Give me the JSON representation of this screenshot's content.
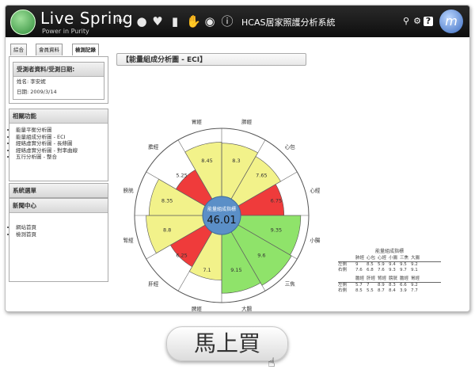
{
  "header": {
    "brand": "Live Spring",
    "inc": "Inc.",
    "tagline": "Power in Purity",
    "title": "HCAS居家照護分析系統",
    "icons": [
      "person-icon",
      "heart-icon",
      "bar-chart-icon",
      "hand-icon",
      "speech-bubble-icon",
      "info-icon"
    ],
    "tools": [
      "search-icon",
      "gear-icon",
      "help-icon"
    ],
    "logo_letter": "m"
  },
  "sidebar": {
    "tabs": [
      "綜合",
      "會員資料",
      "檢測記錄"
    ],
    "recipient": {
      "title": "受測者資料/受測日期:",
      "name": "姓名: 李安妮",
      "date": "日期: 2009/3/14"
    },
    "functions": {
      "title": "相關功能",
      "items": [
        "能量平衡分析圖",
        "能量組成分析圖 - ECI",
        "經絡虛實分析圖 - 長條圖",
        "經絡虛實分析圖 - 對率曲線",
        "五行分析圖 - 整合"
      ]
    },
    "system": {
      "title": "系統選單"
    },
    "news": {
      "title": "新聞中心",
      "items": [
        "網站首頁",
        "檢測首頁"
      ]
    }
  },
  "main": {
    "title": "【能量組成分析圖 - ECI】"
  },
  "chart_data": {
    "type": "radial-bar",
    "center_label": "能量組成指標",
    "center_value": "46.01",
    "segments": [
      {
        "name": "肺經",
        "value": 8.3,
        "color": "#f2f28a"
      },
      {
        "name": "心包",
        "value": 7.65,
        "color": "#f2f28a"
      },
      {
        "name": "心經",
        "value": 6.75,
        "color": "#ef3b3b"
      },
      {
        "name": "小腸",
        "value": 9.35,
        "color": "#8fe36a"
      },
      {
        "name": "三焦",
        "value": 9.6,
        "color": "#8fe36a"
      },
      {
        "name": "大腸",
        "value": 9.15,
        "color": "#8fe36a"
      },
      {
        "name": "脾經",
        "value": 7.1,
        "color": "#f2f28a"
      },
      {
        "name": "肝經",
        "value": 6.25,
        "color": "#ef3b3b"
      },
      {
        "name": "腎經",
        "value": 8.8,
        "color": "#f2f28a"
      },
      {
        "name": "膀胱",
        "value": 8.35,
        "color": "#f2f28a"
      },
      {
        "name": "膽經",
        "value": 5.25,
        "color": "#ef3b3b"
      },
      {
        "name": "胃經",
        "value": 8.45,
        "color": "#f2f28a"
      }
    ]
  },
  "legend": {
    "title": "能量組成指標",
    "top_headers": [
      "肺經",
      "心包",
      "心經",
      "小腸",
      "三焦",
      "大腸"
    ],
    "top_rows": [
      {
        "label": "左側",
        "values": [
          "9",
          "8.5",
          "5.9",
          "9.4",
          "9.5",
          "9.2"
        ]
      },
      {
        "label": "右側",
        "values": [
          "7.6",
          "6.8",
          "7.6",
          "9.3",
          "9.7",
          "9.1"
        ]
      }
    ],
    "bottom_headers": [
      "膽經",
      "肝經",
      "腎經",
      "膀胱",
      "膽經",
      "胃經"
    ],
    "bottom_rows": [
      {
        "label": "左側",
        "values": [
          "5.7",
          "7",
          "8.9",
          "8.3",
          "6.6",
          "9.2"
        ]
      },
      {
        "label": "右側",
        "values": [
          "8.5",
          "5.5",
          "8.7",
          "8.4",
          "3.9",
          "7.7"
        ]
      }
    ]
  },
  "buy_button": {
    "label": "馬上買"
  }
}
